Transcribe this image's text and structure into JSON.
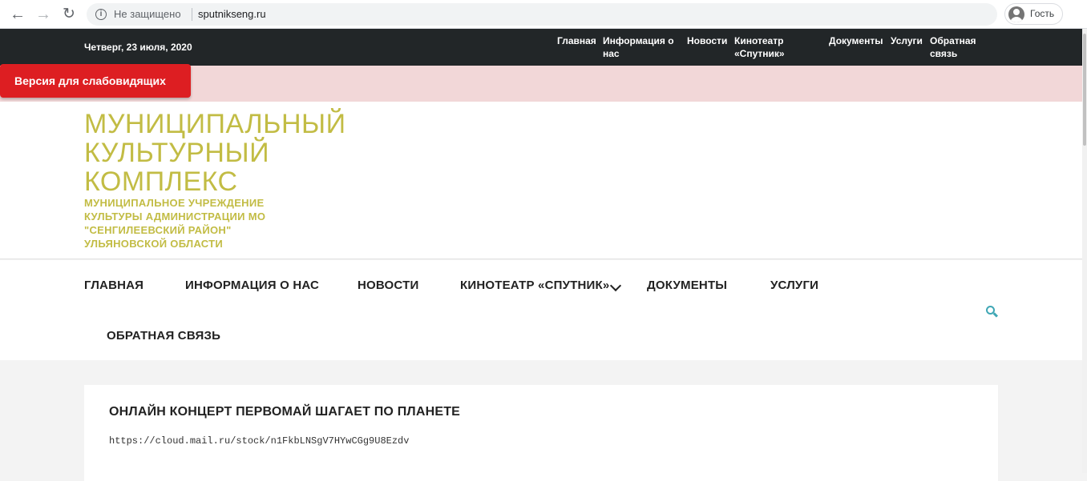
{
  "browser": {
    "security_label": "Не защищено",
    "url": "sputnikseng.ru",
    "profile_label": "Гость"
  },
  "topbar": {
    "date": "Четверг, 23 июля, 2020",
    "nav": [
      "Главная",
      "Информация о нас",
      "Новости",
      "Кинотеатр «Спутник»",
      "Документы",
      "Услуги",
      "Обратная связь"
    ]
  },
  "accessibility": {
    "button_label": "Версия для слабовидящих"
  },
  "header": {
    "title": "МУНИЦИПАЛЬНЫЙ КУЛЬТУРНЫЙ КОМПЛЕКС",
    "subtitle": "МУНИЦИПАЛЬНОЕ УЧРЕЖДЕНИЕ КУЛЬТУРЫ АДМИНИСТРАЦИИ МО \"СЕНГИЛЕЕВСКИЙ РАЙОН\" УЛЬЯНОВСКОЙ ОБЛАСТИ"
  },
  "mainnav": {
    "items": [
      "ГЛАВНАЯ",
      "ИНФОРМАЦИЯ О НАС",
      "НОВОСТИ",
      "КИНОТЕАТР «СПУТНИК»",
      "ДОКУМЕНТЫ",
      "УСЛУГИ",
      "ОБРАТНАЯ СВЯЗЬ"
    ]
  },
  "post": {
    "title": "ОНЛАЙН КОНЦЕРТ ПЕРВОМАЙ ШАГАЕТ ПО ПЛАНЕТЕ",
    "link": "https://cloud.mail.ru/stock/n1FkbLNSgV7HYwCGg9U8Ezdv"
  },
  "colors": {
    "topbar_bg": "#222628",
    "accent_title": "#c2bc44",
    "a11y_button": "#dd1e22",
    "a11y_strip": "#f2d7d8",
    "search_icon": "#3fa7b5"
  }
}
